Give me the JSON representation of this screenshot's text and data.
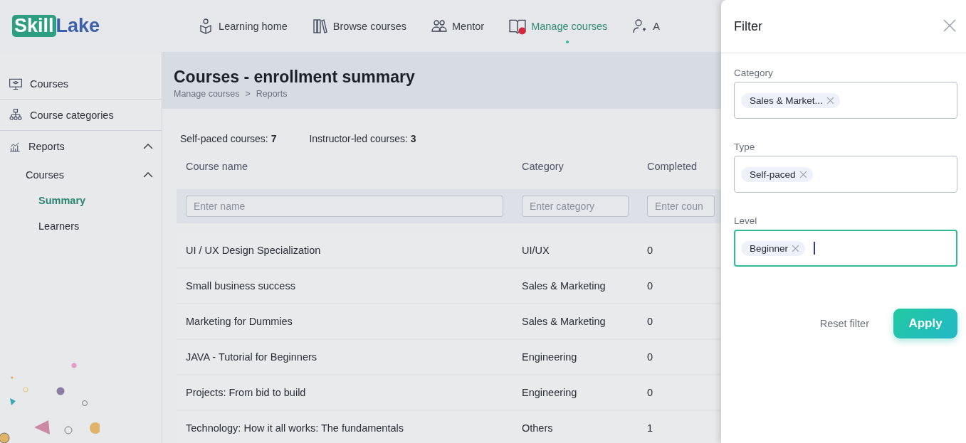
{
  "logo": {
    "boxed": "Skill",
    "plain": "Lake"
  },
  "nav": [
    {
      "label": "Learning home",
      "selected": false
    },
    {
      "label": "Browse courses",
      "selected": false
    },
    {
      "label": "Mentor",
      "selected": false
    },
    {
      "label": "Manage courses",
      "selected": true
    },
    {
      "label": "A",
      "selected": false
    }
  ],
  "sidebar": {
    "items": [
      {
        "label": "Courses",
        "selected": false
      },
      {
        "label": "Course categories",
        "selected": false
      },
      {
        "label": "Reports",
        "selected": false,
        "expanded": true,
        "children": [
          {
            "label": "Courses",
            "selected": false,
            "expanded": true,
            "children": [
              {
                "label": "Summary",
                "selected": true
              },
              {
                "label": "Learners",
                "selected": false
              }
            ]
          }
        ]
      }
    ]
  },
  "page": {
    "title": "Courses - enrollment summary",
    "breadcrumb": [
      "Manage courses",
      "Reports"
    ],
    "breadcrumb_separator": ">",
    "stats": [
      {
        "label": "Self-paced courses:",
        "value": "7"
      },
      {
        "label": "Instructor-led courses:",
        "value": "3"
      }
    ]
  },
  "table": {
    "columns": [
      {
        "label": "Course name",
        "placeholder": "Enter name"
      },
      {
        "label": "Category",
        "placeholder": "Enter category"
      },
      {
        "label": "Completed",
        "placeholder": "Enter coun"
      }
    ],
    "rows": [
      [
        "UI / UX Design Specialization",
        "UI/UX",
        "0"
      ],
      [
        "Small business success",
        "Sales & Marketing",
        "0"
      ],
      [
        "Marketing for Dummies",
        "Sales & Marketing",
        "0"
      ],
      [
        "JAVA - Tutorial for Beginners",
        "Engineering",
        "0"
      ],
      [
        "Projects: From bid to build",
        "Engineering",
        "0"
      ],
      [
        "Technology: How it all works: The fundamentals",
        "Others",
        "1"
      ]
    ]
  },
  "filter": {
    "title": "Filter",
    "fields": [
      {
        "label": "Category",
        "chips": [
          "Sales & Market..."
        ],
        "focused": false
      },
      {
        "label": "Type",
        "chips": [
          "Self-paced"
        ],
        "focused": false
      },
      {
        "label": "Level",
        "chips": [
          "Beginner"
        ],
        "focused": true
      }
    ],
    "reset": "Reset filter",
    "apply": "Apply"
  }
}
